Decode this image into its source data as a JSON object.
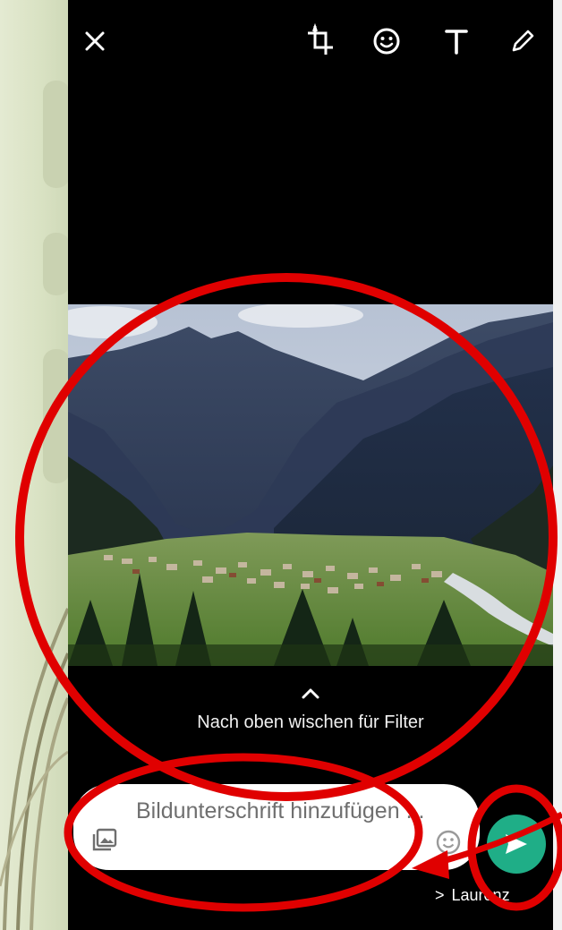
{
  "toolbar": {
    "close_icon": "close-icon",
    "crop_icon": "crop-rotate-icon",
    "emoji_icon": "smiley-icon",
    "text_icon": "text-icon",
    "draw_icon": "pencil-icon"
  },
  "photo": {
    "description_icon": "landscape-photo"
  },
  "filter_hint": {
    "chevron_icon": "chevron-up-icon",
    "text": "Nach oben wischen für Filter"
  },
  "caption": {
    "placeholder": "Bildunterschrift hinzufügen ...",
    "gallery_icon": "gallery-icon",
    "emoji_icon": "emoji-icon"
  },
  "send": {
    "icon": "send-icon",
    "color": "#1fae87"
  },
  "recipient": {
    "arrow": ">",
    "name": "Laurenz"
  },
  "annotation": {
    "color": "#e00000"
  }
}
